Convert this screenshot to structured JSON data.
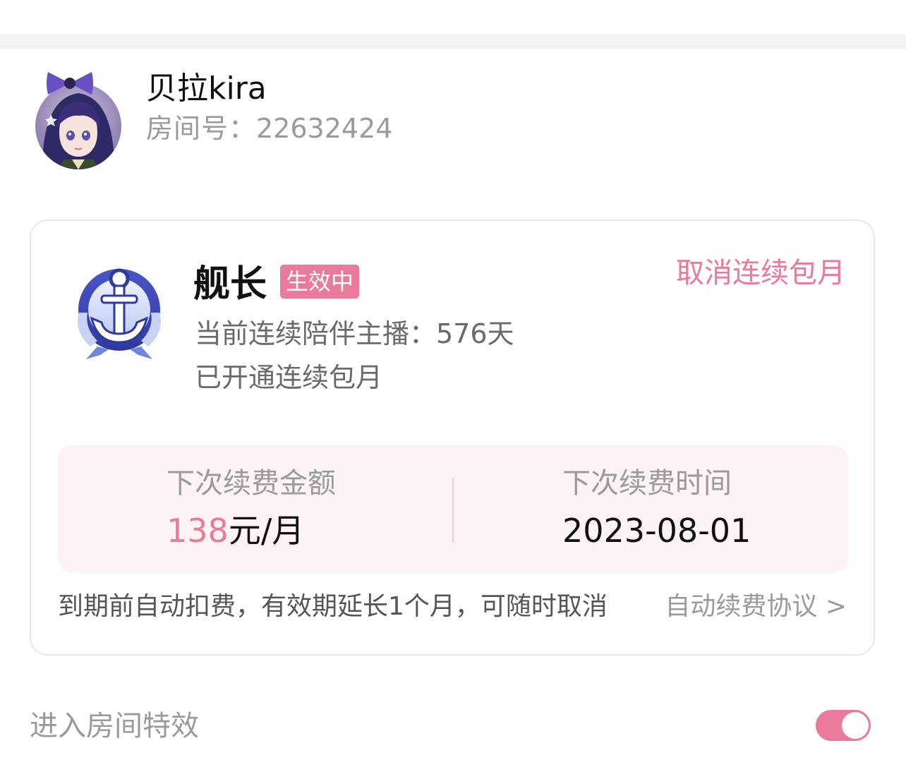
{
  "anchor": {
    "name": "贝拉kira",
    "room_label": "房间号：",
    "room_number": "22632424"
  },
  "guard": {
    "title": "舰长",
    "status": "生效中",
    "cancel_label": "取消连续包月",
    "companion_text": "当前连续陪伴主播：576天",
    "subscription_text": "已开通连续包月"
  },
  "renewal": {
    "amount_label": "下次续费金额",
    "amount_number": "138",
    "amount_unit": "元/月",
    "time_label": "下次续费时间",
    "time_value": "2023-08-01"
  },
  "note": {
    "text": "到期前自动扣费，有效期延长1个月，可随时取消",
    "agreement_label": "自动续费协议 >"
  },
  "effect": {
    "label": "进入房间特效",
    "enabled": true
  },
  "colors": {
    "accent": "#ea7a9a",
    "panel_bg": "#fdf3f5"
  },
  "icons": {
    "avatar": "anchor-avatar-icon",
    "badge": "anchor-badge-icon"
  }
}
